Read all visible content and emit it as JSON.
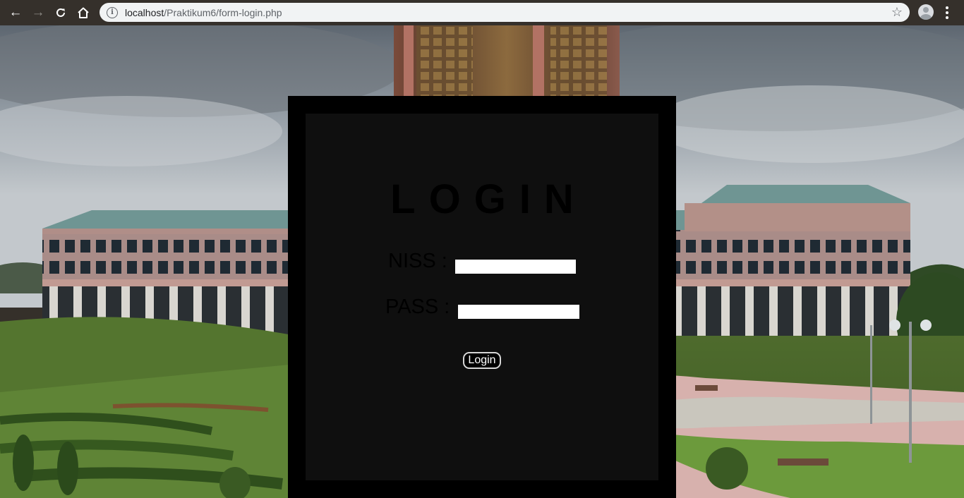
{
  "browser": {
    "url_host": "localhost",
    "url_path": "/Praktikum6/form-login.php",
    "icons": {
      "back": "back-arrow-icon",
      "forward": "forward-arrow-icon",
      "reload": "reload-icon",
      "home": "home-icon",
      "info": "info-icon",
      "bookmark": "star-icon",
      "profile": "profile-icon",
      "menu": "kebab-menu-icon"
    }
  },
  "login": {
    "title": "LOGIN",
    "niss_label": "NISS :",
    "niss_value": "",
    "pass_label": "PASS :",
    "pass_value": "",
    "button_label": "Login"
  },
  "colors": {
    "frame": "#000000",
    "input_bg": "#ffffff",
    "button_bg": "#000000",
    "button_text": "#ffffff"
  }
}
